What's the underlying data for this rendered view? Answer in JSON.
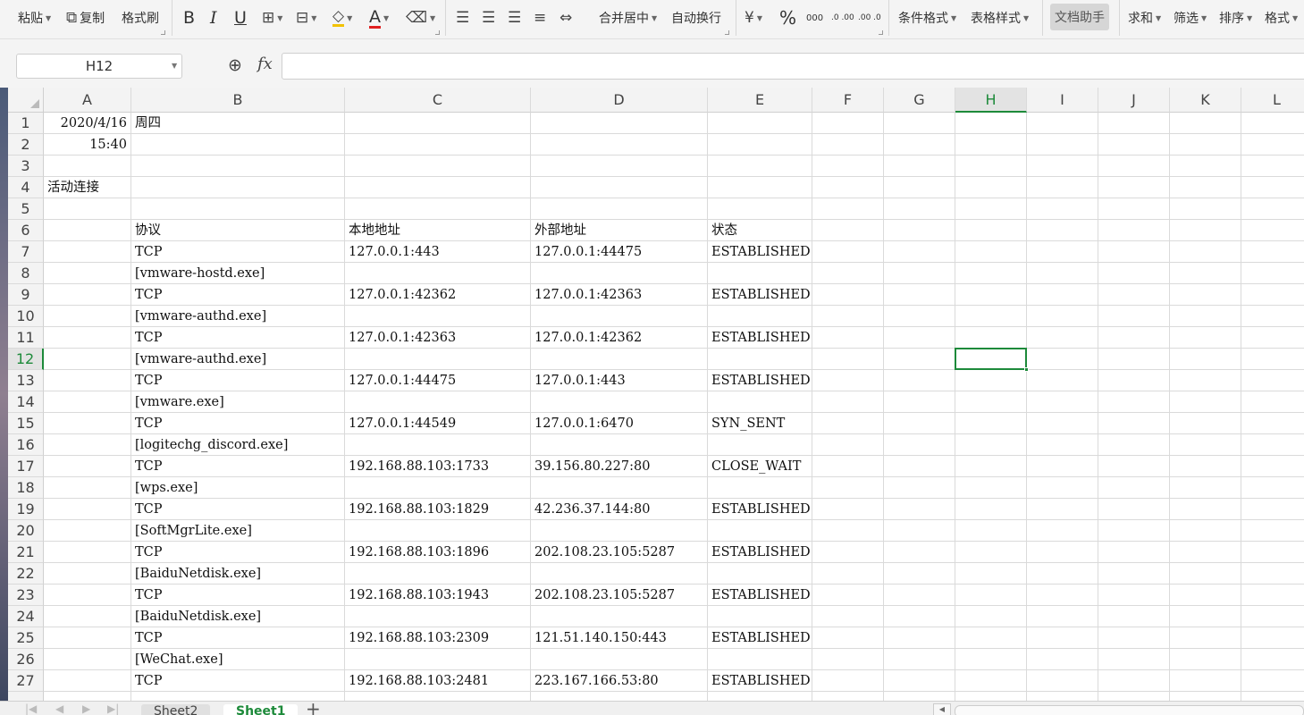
{
  "ribbon": {
    "paste": "粘贴",
    "copy": "复制",
    "format_painter": "格式刷",
    "bold": "B",
    "italic": "I",
    "underline": "U",
    "font_color_letter": "A",
    "merge_center": "合并居中",
    "wrap_text": "自动换行",
    "percent": "%",
    "thousands": "000",
    "inc_decimal": ".0 .00",
    "dec_decimal": ".00 .0",
    "conditional_format": "条件格式",
    "table_style": "表格样式",
    "doc_assistant": "文档助手",
    "sum": "求和",
    "filter": "筛选",
    "sort": "排序",
    "format": "格式"
  },
  "formula_bar": {
    "name_box": "H12",
    "fx": "fx",
    "formula": ""
  },
  "columns": [
    "A",
    "B",
    "C",
    "D",
    "E",
    "F",
    "G",
    "H",
    "I",
    "J",
    "K",
    "L"
  ],
  "selected_column": "H",
  "selected_row": "12",
  "rows": [
    {
      "n": "1",
      "A": "2020/4/16",
      "B": "周四"
    },
    {
      "n": "2",
      "A": "15:40"
    },
    {
      "n": "3"
    },
    {
      "n": "4",
      "A": "活动连接"
    },
    {
      "n": "5"
    },
    {
      "n": "6",
      "B": "协议",
      "C": "本地地址",
      "D": "外部地址",
      "E": "状态"
    },
    {
      "n": "7",
      "B": "TCP",
      "C": "127.0.0.1:443",
      "D": "127.0.0.1:44475",
      "E": "ESTABLISHED"
    },
    {
      "n": "8",
      "B": "[vmware-hostd.exe]"
    },
    {
      "n": "9",
      "B": "TCP",
      "C": "127.0.0.1:42362",
      "D": "127.0.0.1:42363",
      "E": "ESTABLISHED"
    },
    {
      "n": "10",
      "B": "[vmware-authd.exe]"
    },
    {
      "n": "11",
      "B": "TCP",
      "C": "127.0.0.1:42363",
      "D": "127.0.0.1:42362",
      "E": "ESTABLISHED"
    },
    {
      "n": "12",
      "B": "[vmware-authd.exe]"
    },
    {
      "n": "13",
      "B": "TCP",
      "C": "127.0.0.1:44475",
      "D": "127.0.0.1:443",
      "E": "ESTABLISHED"
    },
    {
      "n": "14",
      "B": "[vmware.exe]"
    },
    {
      "n": "15",
      "B": "TCP",
      "C": "127.0.0.1:44549",
      "D": "127.0.0.1:6470",
      "E": "SYN_SENT"
    },
    {
      "n": "16",
      "B": "[logitechg_discord.exe]"
    },
    {
      "n": "17",
      "B": "TCP",
      "C": "192.168.88.103:1733",
      "D": "39.156.80.227:80",
      "E": "CLOSE_WAIT"
    },
    {
      "n": "18",
      "B": "[wps.exe]"
    },
    {
      "n": "19",
      "B": "TCP",
      "C": "192.168.88.103:1829",
      "D": "42.236.37.144:80",
      "E": "ESTABLISHED"
    },
    {
      "n": "20",
      "B": "[SoftMgrLite.exe]"
    },
    {
      "n": "21",
      "B": "TCP",
      "C": "192.168.88.103:1896",
      "D": "202.108.23.105:5287",
      "E": "ESTABLISHED"
    },
    {
      "n": "22",
      "B": "[BaiduNetdisk.exe]"
    },
    {
      "n": "23",
      "B": "TCP",
      "C": "192.168.88.103:1943",
      "D": "202.108.23.105:5287",
      "E": "ESTABLISHED"
    },
    {
      "n": "24",
      "B": "[BaiduNetdisk.exe]"
    },
    {
      "n": "25",
      "B": "TCP",
      "C": "192.168.88.103:2309",
      "D": "121.51.140.150:443",
      "E": "ESTABLISHED"
    },
    {
      "n": "26",
      "B": "[WeChat.exe]"
    },
    {
      "n": "27",
      "B": "TCP",
      "C": "192.168.88.103:2481",
      "D": "223.167.166.53:80",
      "E": "ESTABLISHED"
    }
  ],
  "sheets": [
    "Sheet2",
    "Sheet1"
  ],
  "active_sheet": "Sheet1",
  "colors": {
    "accent": "#1d8a3a"
  }
}
